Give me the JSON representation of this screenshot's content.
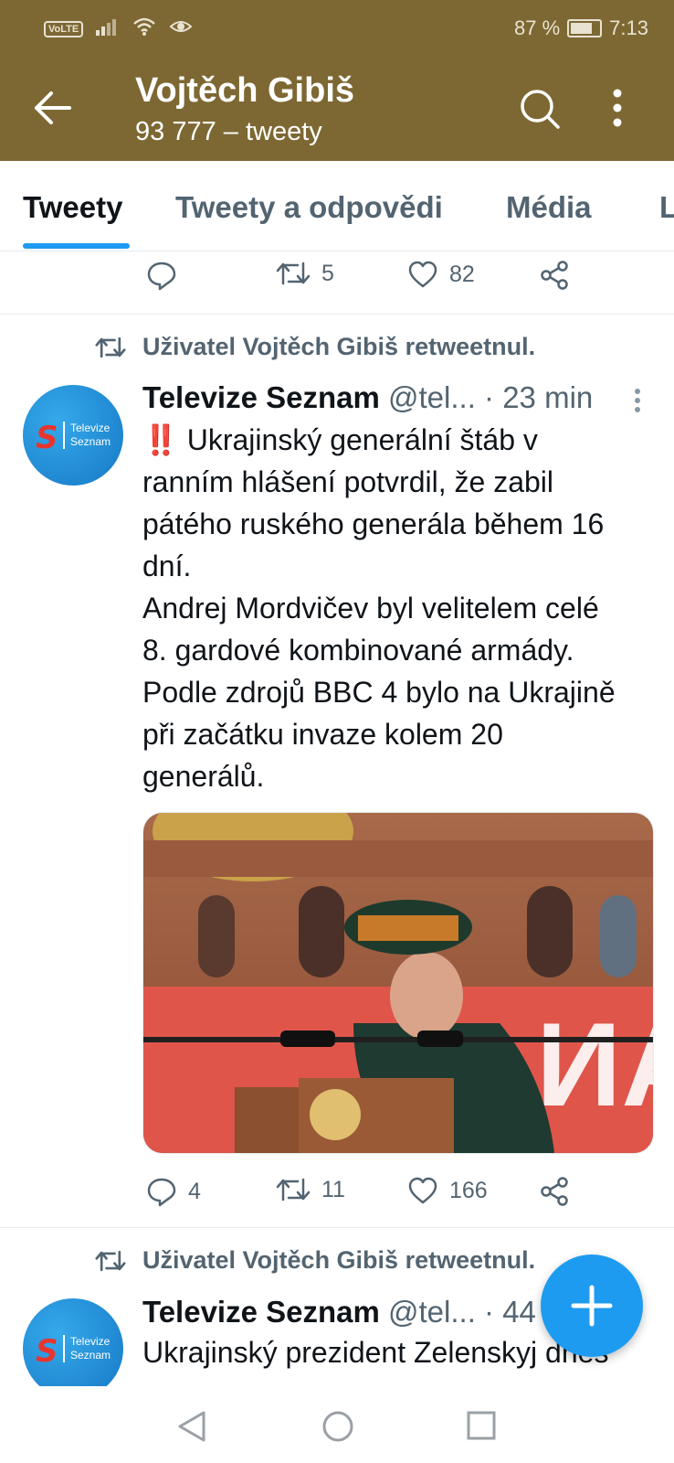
{
  "status_bar": {
    "volte": "VoLTE",
    "battery_percent": "87 %",
    "time": "7:13",
    "battery_level": 0.87
  },
  "header": {
    "title": "Vojtěch Gibiš",
    "subtitle": "93 777 – tweety",
    "color": "#7d6833"
  },
  "tabs": [
    {
      "label": "Tweety",
      "active": true
    },
    {
      "label": "Tweety a odpovědi",
      "active": false
    },
    {
      "label": "Média",
      "active": false
    },
    {
      "label": "L",
      "active": false
    }
  ],
  "prev_tweet_actions": {
    "replies": "",
    "retweets": "5",
    "likes": "82"
  },
  "tweets": [
    {
      "retweet_label": "Uživatel Vojtěch Gibiš retweetnul.",
      "avatar_text_1": "Televize",
      "avatar_text_2": "Seznam",
      "avatar_letter": "S",
      "name": "Televize Seznam",
      "handle": "@tel...",
      "time": "· 23 min",
      "emoji": "‼️",
      "lines": [
        "Ukrajinský generální štáb v",
        "ranním hlášení potvrdil, že zabil",
        "pátého ruského generála během 16",
        "dní.",
        "Andrej Mordvičev byl velitelem celé",
        "8. gardové kombinované armády.",
        "Podle zdrojů BBC 4 bylo na Ukrajině",
        "při začátku invaze kolem 20",
        "generálů."
      ],
      "banner_text": "ИАРА",
      "replies": "4",
      "retweets": "11",
      "likes": "166"
    },
    {
      "retweet_label": "Uživatel Vojtěch Gibiš retweetnul.",
      "avatar_text_1": "Televize",
      "avatar_text_2": "Seznam",
      "avatar_letter": "S",
      "name": "Televize Seznam",
      "handle": "@tel...",
      "time": "· 44",
      "lines": [
        "Ukrajinský prezident Zelenskyj dnes"
      ]
    }
  ],
  "accent_color": "#1d9bf0"
}
